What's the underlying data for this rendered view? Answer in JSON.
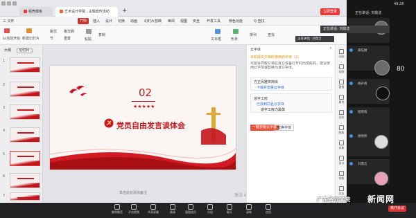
{
  "tabbar": {
    "tabs": [
      {
        "label": "稻壳模板"
      },
      {
        "label": "艺术设计学院...主题宣传活动"
      }
    ],
    "add": "+",
    "login": "立即登录"
  },
  "menubar": {
    "file": "三 文件",
    "items": [
      "开始",
      "插入",
      "设计",
      "切换",
      "动画",
      "幻灯片放映",
      "审阅",
      "视图",
      "安全",
      "开发工具",
      "特色功能"
    ],
    "search": "Q 查找"
  },
  "ribbon": {
    "labels": [
      "从当前开始",
      "新建幻灯片",
      "版式",
      "节",
      "格式刷",
      "重置",
      "粘贴",
      "复制",
      "文本框",
      "形状",
      "排列",
      "查找"
    ]
  },
  "leftpanel": {
    "tab_outline": "大纲",
    "tab_slides": "幻灯片",
    "thumb_numbers": [
      "1",
      "2",
      "3",
      "4",
      "5",
      "6",
      "7",
      "8"
    ]
  },
  "slide": {
    "number": "02",
    "stars": "★★★★★",
    "title": "党员自由发言谈体会",
    "colors": {
      "red": "#c4161c"
    }
  },
  "notes_hint": "单击此处添加备注",
  "activate": "激活 Windows",
  "fontpanel": {
    "title": "云字体",
    "warn": "本机缺失文档所使用的字体（2）",
    "desc": "可能会导致文档在其它设备打开时出现乱码，建议使用云字体或替换为其它字体。",
    "fonts": [
      {
        "name": "方正风雅宋简体",
        "sub": "下载并安装云字体",
        "sample": ""
      },
      {
        "name": "造字工房",
        "sub": "已找到同名云字体",
        "sample": "造字工房力黑体"
      }
    ],
    "btn_all": "一键安装云字体",
    "btn_replace": "替换字体"
  },
  "rail": [
    "动画",
    "动画",
    "窗格",
    "属性",
    "形状",
    "图表",
    "对象",
    "设计",
    "排版",
    "文本"
  ],
  "statusbar": {
    "buttons": [
      "解除静音",
      "开启视频",
      "共享屏幕",
      "邀请",
      "管理成员",
      "分组",
      "聊天",
      "录制",
      "应用"
    ],
    "leave": "离开会议"
  },
  "meeting": {
    "clock": "49:28",
    "speaker": "正在讲话: 刘鼎洁",
    "tooltip": "正在讲话: 刘鼎洁",
    "participants": [
      "黄钰婧",
      "胡开雨",
      "程晓雨",
      "谢晓熙",
      "刘鼎洁"
    ],
    "badge": "80"
  },
  "watermark": {
    "left": "广东省云学院",
    "right": "新闻网"
  }
}
